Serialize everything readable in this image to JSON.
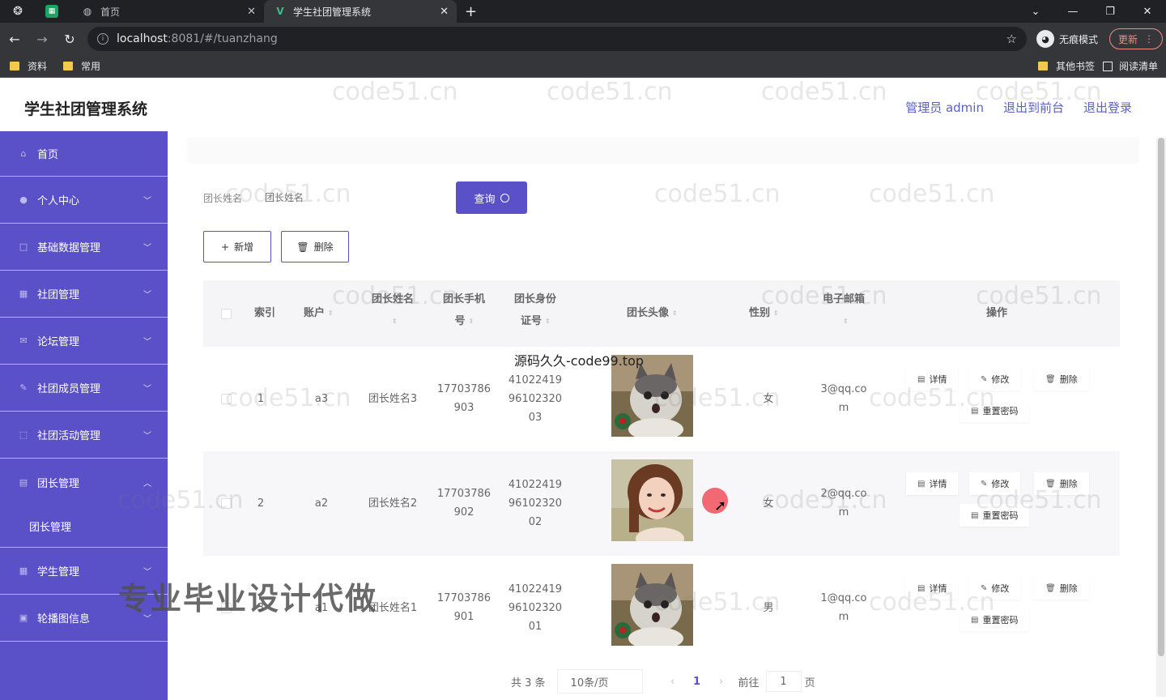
{
  "browser": {
    "tabs": [
      {
        "title": "首页",
        "icon": "globe-icon"
      },
      {
        "title": "学生社团管理系统",
        "icon": "vue-icon"
      }
    ],
    "url_host": "localhost",
    "url_rest": ":8081/#/tuanzhang",
    "incognito_label": "无痕模式",
    "update_label": "更新",
    "bookmarks_left": [
      "资料",
      "常用"
    ],
    "bookmarks_right": [
      "其他书签",
      "阅读清单"
    ]
  },
  "header": {
    "title": "学生社团管理系统",
    "user_label": "管理员 admin",
    "to_front": "退出到前台",
    "logout": "退出登录"
  },
  "sidebar": {
    "items": [
      {
        "label": "首页",
        "icon": "home-icon",
        "expandable": false
      },
      {
        "label": "个人中心",
        "icon": "user-icon",
        "expandable": true
      },
      {
        "label": "基础数据管理",
        "icon": "box-icon",
        "expandable": true
      },
      {
        "label": "社团管理",
        "icon": "grid-icon",
        "expandable": true
      },
      {
        "label": "论坛管理",
        "icon": "mail-icon",
        "expandable": true
      },
      {
        "label": "社团成员管理",
        "icon": "pen-icon",
        "expandable": true
      },
      {
        "label": "社团活动管理",
        "icon": "dashed-box-icon",
        "expandable": true
      },
      {
        "label": "团长管理",
        "icon": "chat-icon",
        "expandable": true,
        "open": true,
        "sub": "团长管理"
      },
      {
        "label": "学生管理",
        "icon": "table-icon",
        "expandable": true
      },
      {
        "label": "轮播图信息",
        "icon": "image-icon",
        "expandable": true
      }
    ]
  },
  "search": {
    "label": "团长姓名",
    "placeholder": "团长姓名",
    "button": "查询"
  },
  "actions": {
    "add": "新增",
    "delete": "删除"
  },
  "table": {
    "headers": {
      "index": "索引",
      "account": "账户",
      "name": "团长姓名",
      "phone_1": "团长手机",
      "phone_2": "号",
      "idcard_1": "团长身份",
      "idcard_2": "证号",
      "avatar": "团长头像",
      "gender": "性别",
      "email": "电子邮箱",
      "ops": "操作"
    },
    "rows": [
      {
        "index": "1",
        "account": "a3",
        "name": "团长姓名3",
        "phone_1": "17703786",
        "phone_2": "903",
        "id_1": "41022419",
        "id_2": "96102320",
        "id_3": "03",
        "avatar": "cat",
        "gender": "女",
        "email_1": "3@qq.co",
        "email_2": "m"
      },
      {
        "index": "2",
        "account": "a2",
        "name": "团长姓名2",
        "phone_1": "17703786",
        "phone_2": "902",
        "id_1": "41022419",
        "id_2": "96102320",
        "id_3": "02",
        "avatar": "girl",
        "gender": "女",
        "email_1": "2@qq.co",
        "email_2": "m"
      },
      {
        "index": "3",
        "account": "a1",
        "name": "团长姓名1",
        "phone_1": "17703786",
        "phone_2": "901",
        "id_1": "41022419",
        "id_2": "96102320",
        "id_3": "01",
        "avatar": "cat",
        "gender": "男",
        "email_1": "1@qq.co",
        "email_2": "m"
      }
    ],
    "ops": {
      "detail": "详情",
      "edit": "修改",
      "delete": "删除",
      "reset": "重置密码"
    }
  },
  "pagination": {
    "total": "共 3 条",
    "page_size": "10条/页",
    "current": "1",
    "goto_label": "前往",
    "goto_value": "1",
    "page_suffix": "页"
  },
  "overlays": {
    "watermark": "code51.cn",
    "promo": "专业毕业设计代做",
    "source_text": "源码久久-code99.top"
  },
  "colors": {
    "primary": "#5a51c9",
    "sidebar_bg": "#5a51c9",
    "header_link": "#5a60c8"
  }
}
